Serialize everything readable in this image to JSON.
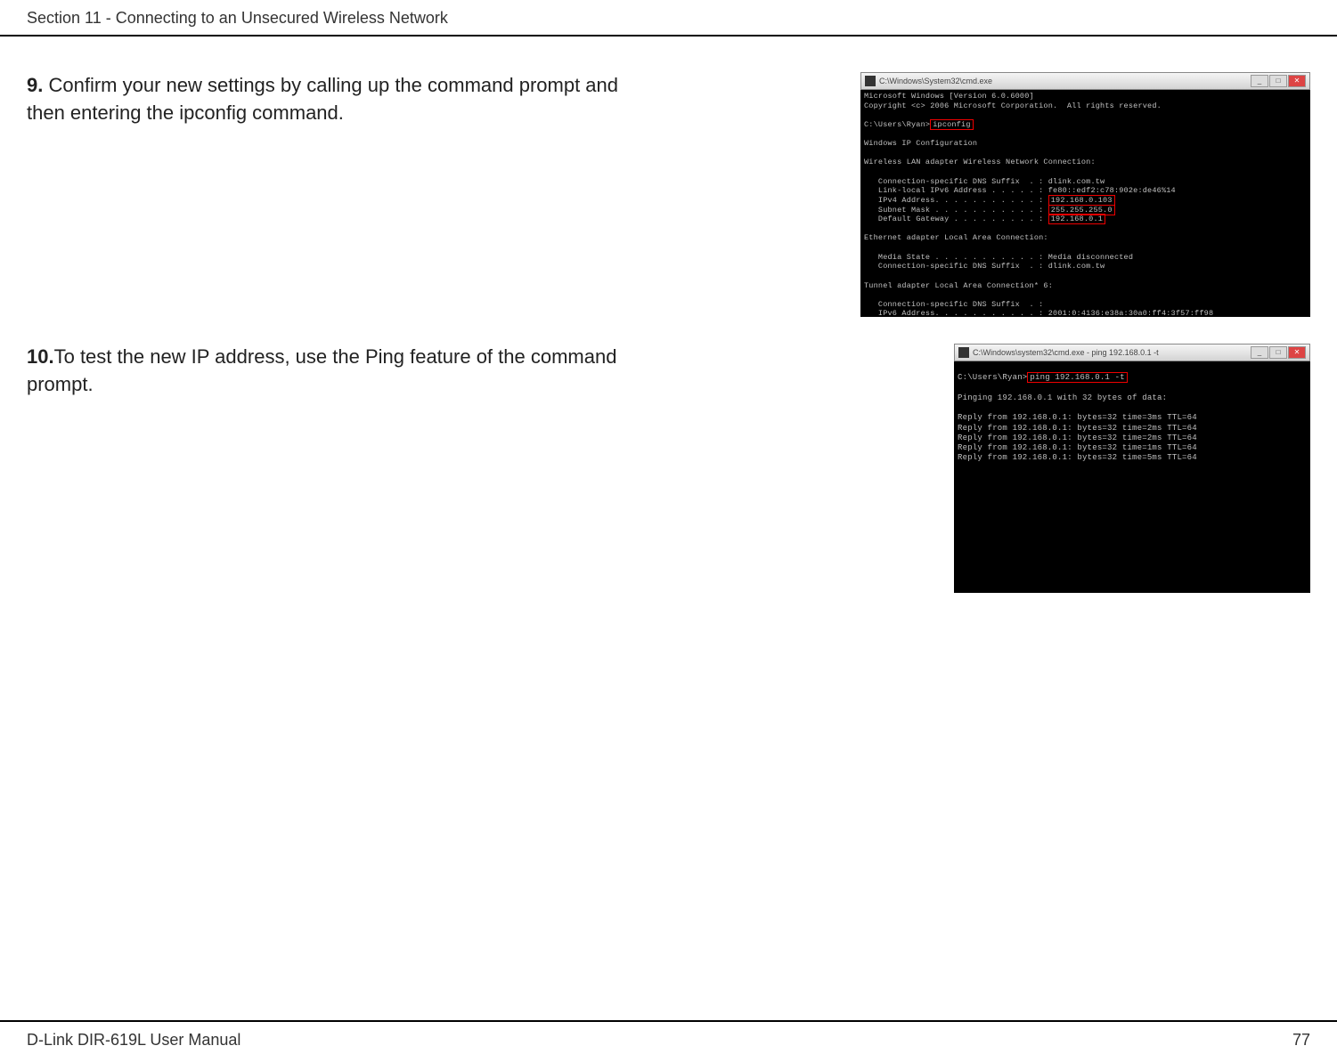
{
  "header": {
    "section_title": "Section 11 - Connecting to an Unsecured Wireless Network"
  },
  "step9": {
    "number": "9.",
    "text": " Confirm your new settings by calling up the command prompt and then entering the ipconfig command.",
    "cmd_title": "C:\\Windows\\System32\\cmd.exe",
    "cmd_line1": "Microsoft Windows [Version 6.0.6000]",
    "cmd_line2": "Copyright <c> 2006 Microsoft Corporation.  All rights reserved.",
    "cmd_prompt": "C:\\Users\\Ryan>",
    "cmd_command": "ipconfig",
    "cmd_heading1": "Windows IP Configuration",
    "cmd_heading2": "Wireless LAN adapter Wireless Network Connection:",
    "cmd_dns": "   Connection-specific DNS Suffix  . : dlink.com.tw",
    "cmd_ipv6_label": "   Link-local IPv6 Address . . . . . : ",
    "cmd_ipv6_value": "fe80::edf2:c78:902e:de46%14",
    "cmd_ipv4_label": "   IPv4 Address. . . . . . . . . . . : ",
    "cmd_ipv4_value": "192.168.0.103",
    "cmd_subnet_label": "   Subnet Mask . . . . . . . . . . . : ",
    "cmd_subnet_value": "255.255.255.0",
    "cmd_gateway_label": "   Default Gateway . . . . . . . . . : ",
    "cmd_gateway_value": "192.168.0.1",
    "cmd_heading3": "Ethernet adapter Local Area Connection:",
    "cmd_media": "   Media State . . . . . . . . . . . : Media disconnected",
    "cmd_dns2": "   Connection-specific DNS Suffix  . : dlink.com.tw",
    "cmd_heading4": "Tunnel adapter Local Area Connection* 6:",
    "cmd_dns3": "   Connection-specific DNS Suffix  . :",
    "cmd_ipv6b": "   IPv6 Address. . . . . . . . . . . : 2001:0:4136:e38a:30a0:ff4:3f57:ff98"
  },
  "step10": {
    "number": "10.",
    "text": "To test the new IP address, use the Ping feature of the command prompt.",
    "cmd_title": "C:\\Windows\\system32\\cmd.exe - ping  192.168.0.1 -t",
    "cmd_prompt": "C:\\Users\\Ryan>",
    "cmd_command": "ping 192.168.0.1 -t",
    "cmd_pinging": "Pinging 192.168.0.1 with 32 bytes of data:",
    "cmd_reply1": "Reply from 192.168.0.1: bytes=32 time=3ms TTL=64",
    "cmd_reply2": "Reply from 192.168.0.1: bytes=32 time=2ms TTL=64",
    "cmd_reply3": "Reply from 192.168.0.1: bytes=32 time=2ms TTL=64",
    "cmd_reply4": "Reply from 192.168.0.1: bytes=32 time=1ms TTL=64",
    "cmd_reply5": "Reply from 192.168.0.1: bytes=32 time=5ms TTL=64"
  },
  "footer": {
    "manual_name": "D-Link DIR-619L User Manual",
    "page_number": "77"
  }
}
